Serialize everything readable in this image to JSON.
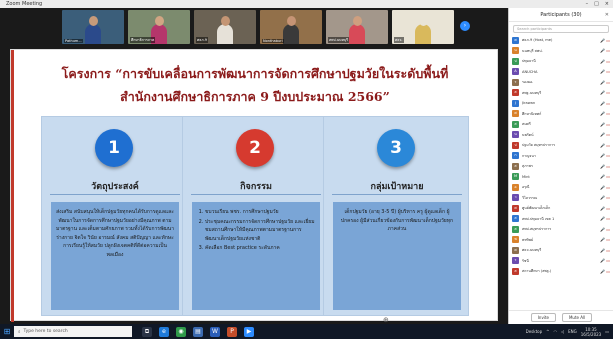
{
  "window": {
    "title": "Zoom Meeting",
    "controls": [
      "–",
      "□",
      "×"
    ]
  },
  "video_strip": [
    {
      "name": "Pathum...",
      "bg": "#3b5e7a",
      "shirt": "#2b4a8b",
      "skin": "#c79a7a"
    },
    {
      "name": "ศึกษาธิการภาค",
      "bg": "#7c8b6e",
      "shirt": "#b5366b",
      "skin": "#d1a583"
    },
    {
      "name": "ศธภ.9",
      "bg": "#6b6254",
      "shirt": "#e6e1d8",
      "skin": "#c49574"
    },
    {
      "name": "Nonthaburi",
      "bg": "#92704a",
      "shirt": "#3a3a3a",
      "skin": "#c69475"
    },
    {
      "name": "สพป.นนทบุรี",
      "bg": "#a3978b",
      "shirt": "#d84a58",
      "skin": "#cf9f7f"
    },
    {
      "name": "ศธจ.",
      "bg": "#e9e4d6",
      "shirt": "#d9b95c",
      "skin": "#e9e4d6"
    }
  ],
  "slide": {
    "title_line1": "โครงการ “การขับเคลื่อนการพัฒนาการจัดการศึกษาปฐมวัยในระดับพื้นที่",
    "title_line2": "สำนักงานศึกษาธิการภาค 9 ปีงบประมาณ 2566”",
    "cards": [
      {
        "number": "1",
        "color": "#1f6fd1",
        "heading": "วัตถุประสงค์",
        "body": "ส่งเสริม สนับสนุนให้เด็กปฐมวัยทุกคนได้รับการดูแลและพัฒนาในการจัดการศึกษาปฐมวัยอย่างมีคุณภาพ ตามมาตรฐาน และเต็มตามศักยภาพ รวมทั้งได้รับการพัฒนาร่างกาย จิตใจ วินัย อารมณ์ สังคม สติปัญญา และทักษะการเรียนรู้ให้สมวัย ปลูกฝังเจตคติที่ดีต่อความเป็นพลเมือง"
      },
      {
        "number": "2",
        "color": "#d63a2f",
        "heading": "กิจกรรม",
        "items": [
          "ขบวนเรียน พชร. การศึกษาปฐมวัย",
          "ประชุมคณะกรรมการจัดการศึกษาปฐมวัย และเยี่ยมชมสถานศึกษาให้มีคุณภาพตามมาตรฐานการพัฒนาเด็กปฐมวัยแห่งชาติ",
          "คัดเลือก Best practice ระดับภาค"
        ]
      },
      {
        "number": "3",
        "color": "#2b88d8",
        "heading": "กลุ่มเป้าหมาย",
        "body": "เด็กปฐมวัย (อายุ 3-5 ปี) ผู้บริหาร ครู ผู้ดูแลเด็ก ผู้ปกครอง ผู้มีส่วนเกี่ยวข้องกับการพัฒนาเด็กปฐมวัยทุกภาคส่วน"
      }
    ],
    "cursor": "⊕"
  },
  "participants": {
    "title": "Participants (30)",
    "search_placeholder": "Search participants",
    "list": [
      {
        "initial": "ศ",
        "color": "#2e75d0",
        "name": "ศธภ.9 (Host, me)",
        "status": "🎤 ▭"
      },
      {
        "initial": "น",
        "color": "#d9822b",
        "name": "นนทบุรี สพป.",
        "status": "🎤 ▭"
      },
      {
        "initial": "ป",
        "color": "#3a9b57",
        "name": "ปทุมธานี",
        "status": "🎤 ▭"
      },
      {
        "initial": "A",
        "color": "#6b4caf",
        "name": "ANUCHA",
        "status": "🎤 ▭"
      },
      {
        "initial": "ร",
        "color": "#8c6f4e",
        "name": "รองผอ.",
        "status": "🎤 ▭"
      },
      {
        "initial": "ส",
        "color": "#c0392b",
        "name": "สพฐ.นนทบุรี",
        "status": "🎤 ▭"
      },
      {
        "initial": "J",
        "color": "#2e75d0",
        "name": "Jirawan",
        "status": "🎤 ▭"
      },
      {
        "initial": "ศ",
        "color": "#d9822b",
        "name": "ศึกษานิเทศก์",
        "status": "🎤 ▭"
      },
      {
        "initial": "ส",
        "color": "#3a9b57",
        "name": "สมศรี",
        "status": "🎤 ▭"
      },
      {
        "initial": "น",
        "color": "#6b4caf",
        "name": "นพรัตน์",
        "status": "🎤 ▭"
      },
      {
        "initial": "ป",
        "color": "#c0392b",
        "name": "ปฐมวัย สมุทรปราการ",
        "status": "🎤 ▭"
      },
      {
        "initial": "ก",
        "color": "#2e75d0",
        "name": "กาญจนา",
        "status": "🎤 ▭"
      },
      {
        "initial": "ส",
        "color": "#8c6f4e",
        "name": "สุภาพร",
        "status": "🎤 ▭"
      },
      {
        "initial": "M",
        "color": "#3a9b57",
        "name": "Mint",
        "status": "🎤 ▭"
      },
      {
        "initial": "อ",
        "color": "#d9822b",
        "name": "อรุณี",
        "status": "🎤 ▭"
      },
      {
        "initial": "ว",
        "color": "#6b4caf",
        "name": "วิไลวรรณ",
        "status": "🎤 ▭"
      },
      {
        "initial": "ศ",
        "color": "#c0392b",
        "name": "ศูนย์พัฒนาเด็กเล็ก",
        "status": "🎤 ▭"
      },
      {
        "initial": "ส",
        "color": "#2e75d0",
        "name": "สพป.ปทุมธานี เขต 1",
        "status": "🎤 ▭"
      },
      {
        "initial": "ส",
        "color": "#3a9b57",
        "name": "สพป.สมุทรปราการ",
        "status": "🎤 ▭"
      },
      {
        "initial": "พ",
        "color": "#d9822b",
        "name": "พรทิพย์",
        "status": "🎤 ▭"
      },
      {
        "initial": "ศ",
        "color": "#8c6f4e",
        "name": "ศธจ.นนทบุรี",
        "status": "🎤 ▭"
      },
      {
        "initial": "ร",
        "color": "#6b4caf",
        "name": "รัชนี",
        "status": "🎤 ▭"
      },
      {
        "initial": "ส",
        "color": "#c0392b",
        "name": "สถานศึกษา (สพฐ.)",
        "status": "🎤 ▭"
      }
    ],
    "invite_label": "Invite",
    "mute_all_label": "Mute All"
  },
  "taskbar": {
    "search_placeholder": "Type here to search",
    "apps": [
      {
        "icon": "task-view-icon",
        "glyph": "⧉",
        "color": "#2a3446"
      },
      {
        "icon": "edge-icon",
        "glyph": "e",
        "color": "#1f7ad8"
      },
      {
        "icon": "chrome-icon",
        "glyph": "◉",
        "color": "#2f9a4a"
      },
      {
        "icon": "store-icon",
        "glyph": "▤",
        "color": "#3b6ab0"
      },
      {
        "icon": "word-icon",
        "glyph": "W",
        "color": "#2b5eb8"
      },
      {
        "icon": "powerpoint-icon",
        "glyph": "P",
        "color": "#c44e2b"
      },
      {
        "icon": "zoom-icon",
        "glyph": "▶",
        "color": "#2d8cff"
      }
    ],
    "tray_text": "Desktop",
    "lang": "ENG",
    "time": "10:35",
    "date": "16/5/2023"
  }
}
